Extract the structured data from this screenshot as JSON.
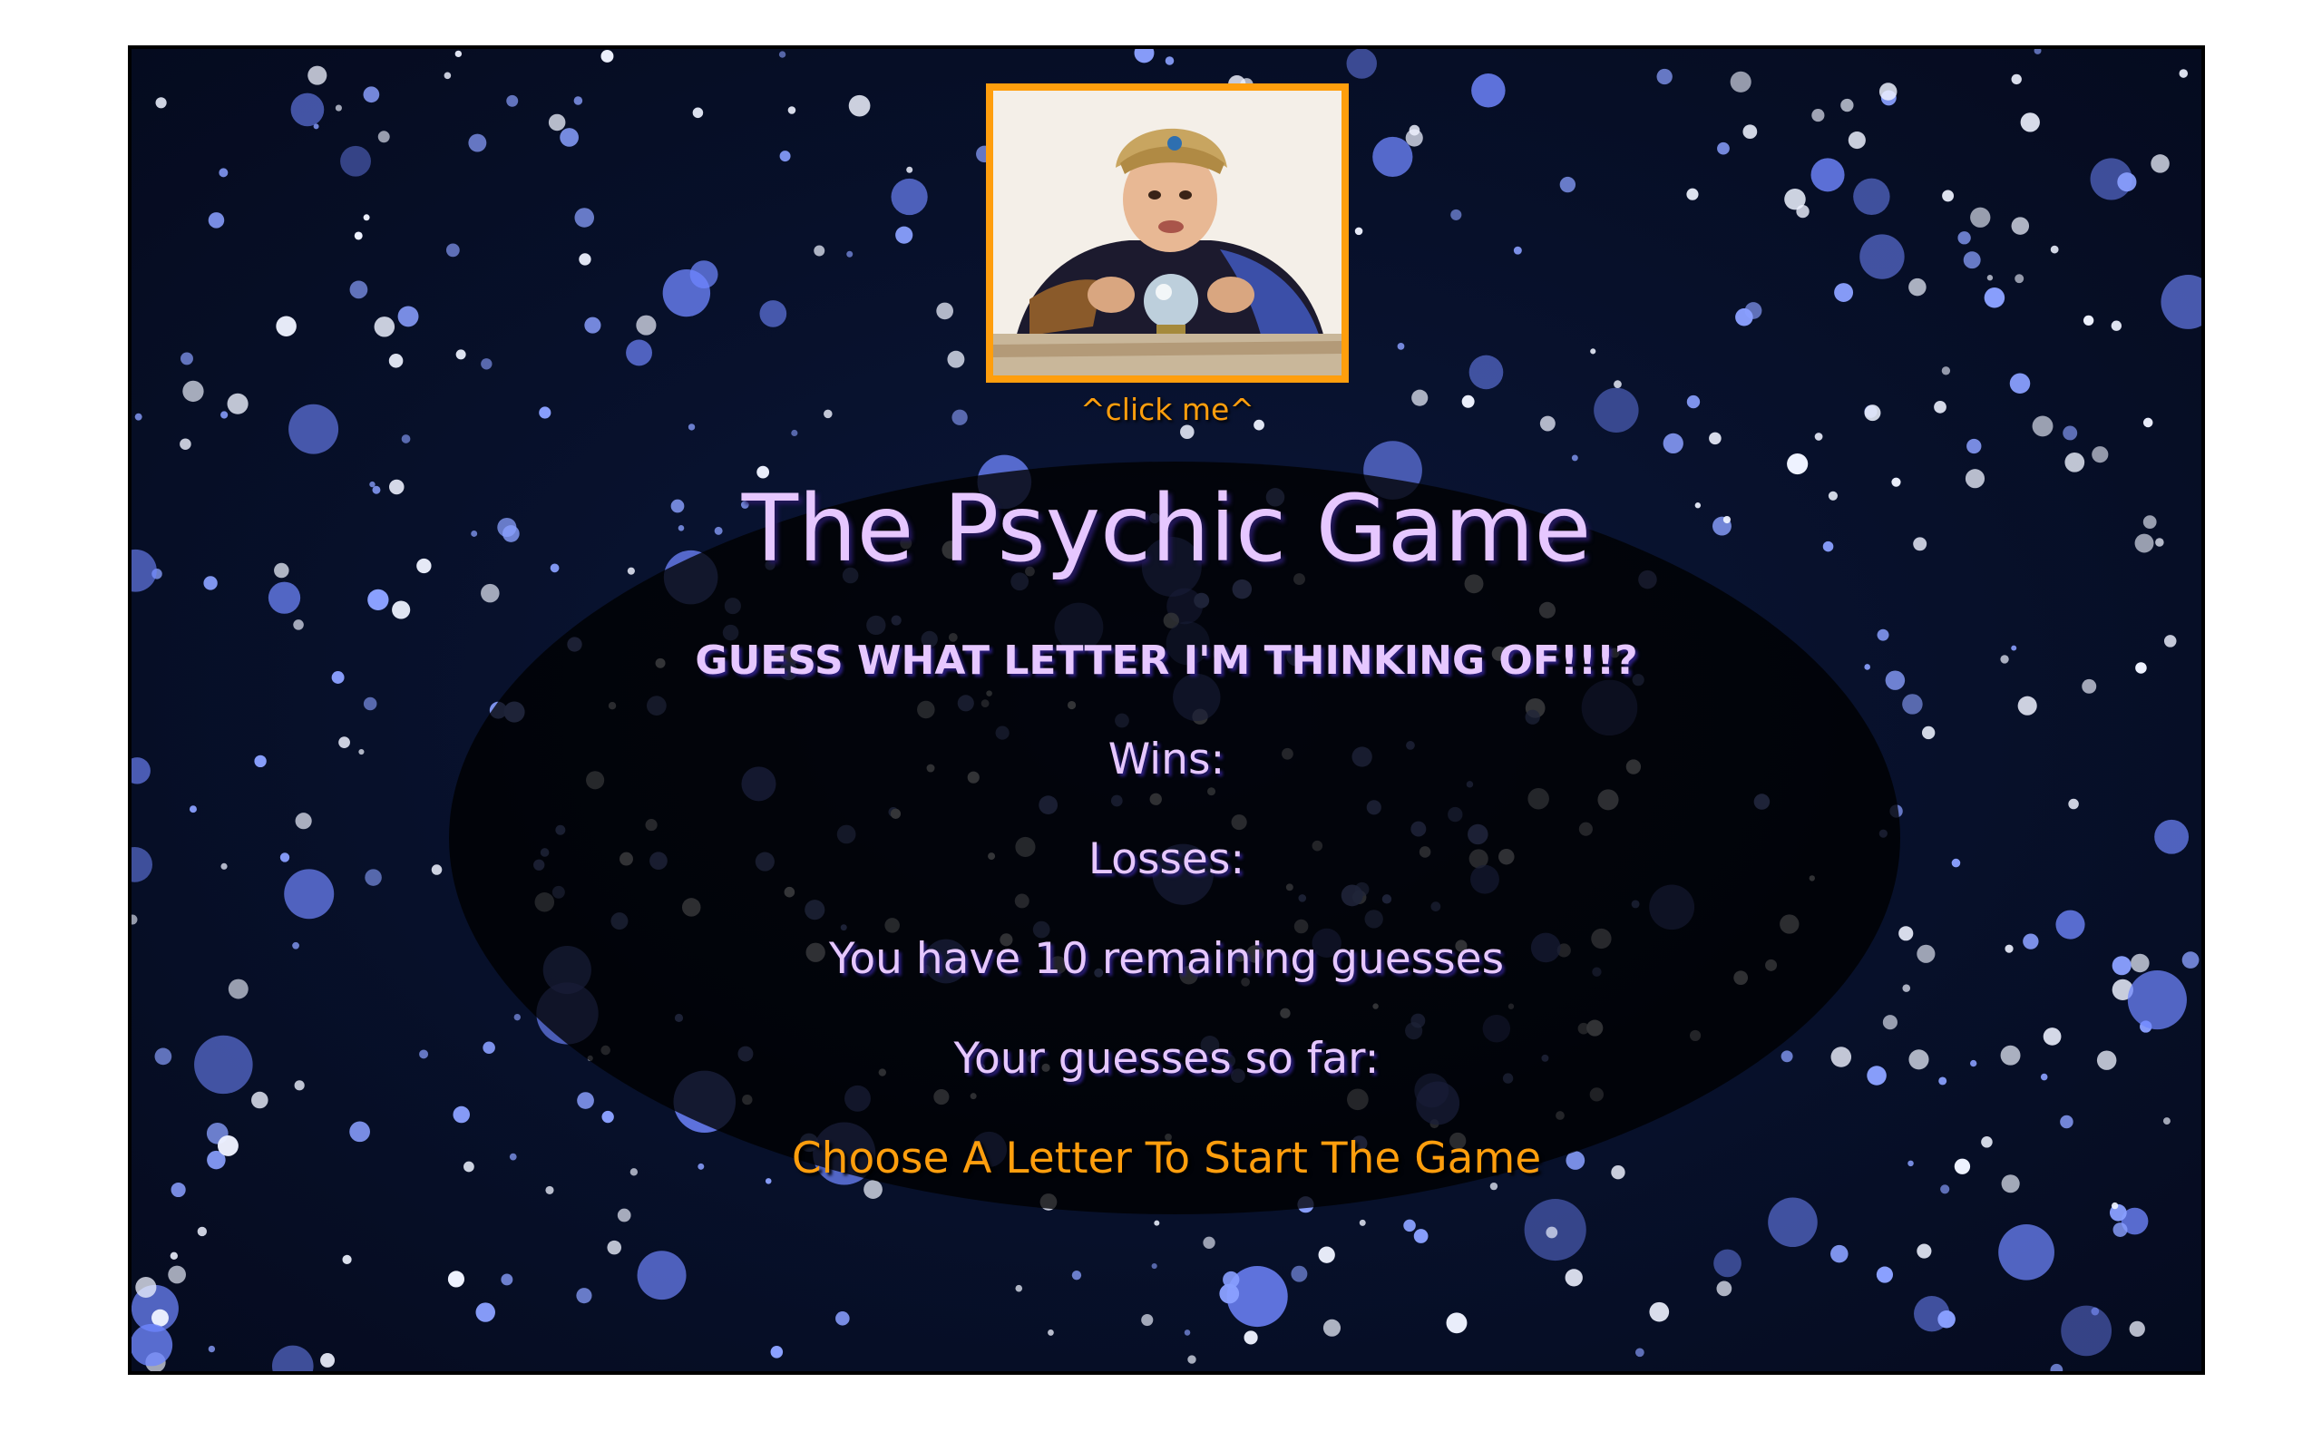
{
  "colors": {
    "accent": "#ff9e0d",
    "text": "#e6c7ff",
    "background": "#07102a",
    "frame": "#000000"
  },
  "header": {
    "image_icon": "fortune-teller-portrait",
    "click_hint": "^click me^"
  },
  "main": {
    "title": "The Psychic Game",
    "subtitle": "GUESS WHAT LETTER I'M THINKING OF!!!?",
    "wins_label": "Wins:",
    "losses_label": "Losses:",
    "remaining_text": "You have 10 remaining guesses",
    "guesses_label": "Your guesses so far:",
    "start_prompt": "Choose A Letter To Start The Game"
  }
}
